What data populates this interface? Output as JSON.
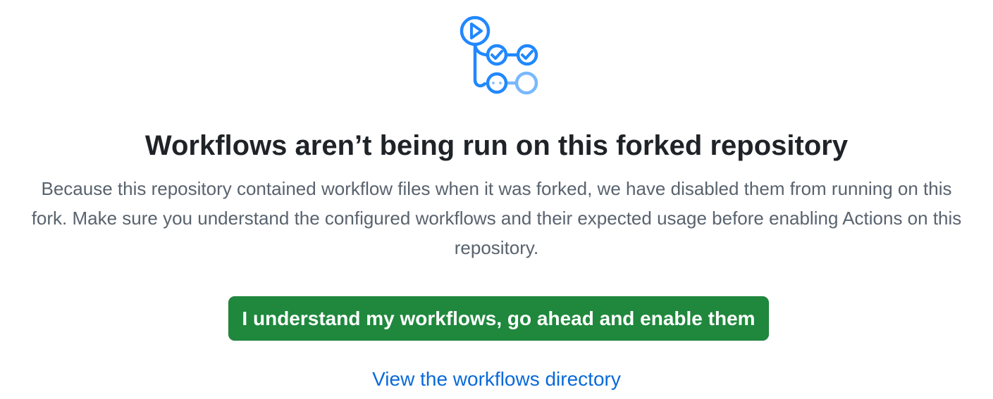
{
  "illustration": {
    "icon": "actions-workflow-icon",
    "colors": {
      "primary": "#2188ff",
      "secondary": "#79b8ff"
    }
  },
  "heading": "Workflows aren’t being run on this forked repository",
  "description": "Because this repository contained workflow files when it was forked, we have disabled them from running on this fork. Make sure you understand the configured workflows and their expected usage before enabling Actions on this repository.",
  "enable_button": {
    "label": "I understand my workflows, go ahead and enable them",
    "color": "#1f883d"
  },
  "directory_link": {
    "label": "View the workflows directory",
    "color": "#0969da"
  }
}
